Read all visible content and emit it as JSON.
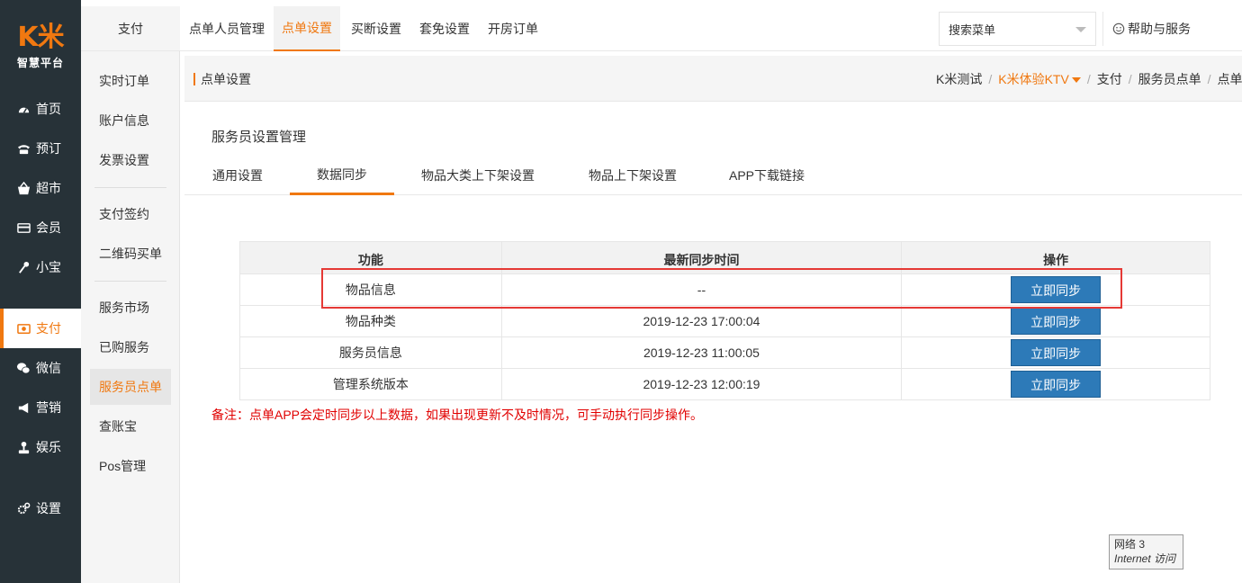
{
  "brand": {
    "logo_text": "K米",
    "logo_sub": "智慧平台",
    "accent": "#f07810",
    "sidebar_bg": "#273238",
    "button_blue": "#2d7ab8"
  },
  "main_nav": [
    {
      "label": "首页",
      "icon": "dashboard-icon"
    },
    {
      "label": "预订",
      "icon": "phone-icon"
    },
    {
      "label": "超市",
      "icon": "basket-icon"
    },
    {
      "label": "会员",
      "icon": "card-icon"
    },
    {
      "label": "小宝",
      "icon": "microphone-icon"
    },
    {
      "label": "支付",
      "icon": "pay-icon",
      "active": true
    },
    {
      "label": "微信",
      "icon": "wechat-icon"
    },
    {
      "label": "营销",
      "icon": "megaphone-icon"
    },
    {
      "label": "娱乐",
      "icon": "joystick-icon"
    },
    {
      "label": "设置",
      "icon": "gear-icon"
    }
  ],
  "sub_nav": {
    "title": "支付",
    "items": [
      "实时订单",
      "账户信息",
      "发票设置",
      "支付签约",
      "二维码买单",
      "服务市场",
      "已购服务",
      "服务员点单",
      "查账宝",
      "Pos管理"
    ],
    "active": "服务员点单"
  },
  "top_tabs": [
    "点单人员管理",
    "点单设置",
    "买断设置",
    "套免设置",
    "开房订单"
  ],
  "top_tab_active": "点单设置",
  "search": {
    "placeholder": "搜索菜单"
  },
  "help": {
    "label": "帮助与服务"
  },
  "crumb": {
    "title": "点单设置",
    "items": [
      "K米测试",
      "K米体验KTV",
      "支付",
      "服务员点单",
      "点单设"
    ]
  },
  "page": {
    "title": "服务员设置管理",
    "tabs": [
      "通用设置",
      "数据同步",
      "物品大类上下架设置",
      "物品上下架设置",
      "APP下载链接"
    ],
    "active_tab": "数据同步"
  },
  "sync_table": {
    "headers": [
      "功能",
      "最新同步时间",
      "操作"
    ],
    "rows": [
      {
        "func": "物品信息",
        "time": "--",
        "action": "立即同步"
      },
      {
        "func": "物品种类",
        "time": "2019-12-23 17:00:04",
        "action": "立即同步"
      },
      {
        "func": "服务员信息",
        "time": "2019-12-23 11:00:05",
        "action": "立即同步"
      },
      {
        "func": "管理系统版本",
        "time": "2019-12-23 12:00:19",
        "action": "立即同步"
      }
    ]
  },
  "note": "备注：点单APP会定时同步以上数据，如果出现更新不及时情况，可手动执行同步操作。",
  "net_badge": {
    "line1": "网络 3",
    "line2": "Internet 访问"
  }
}
